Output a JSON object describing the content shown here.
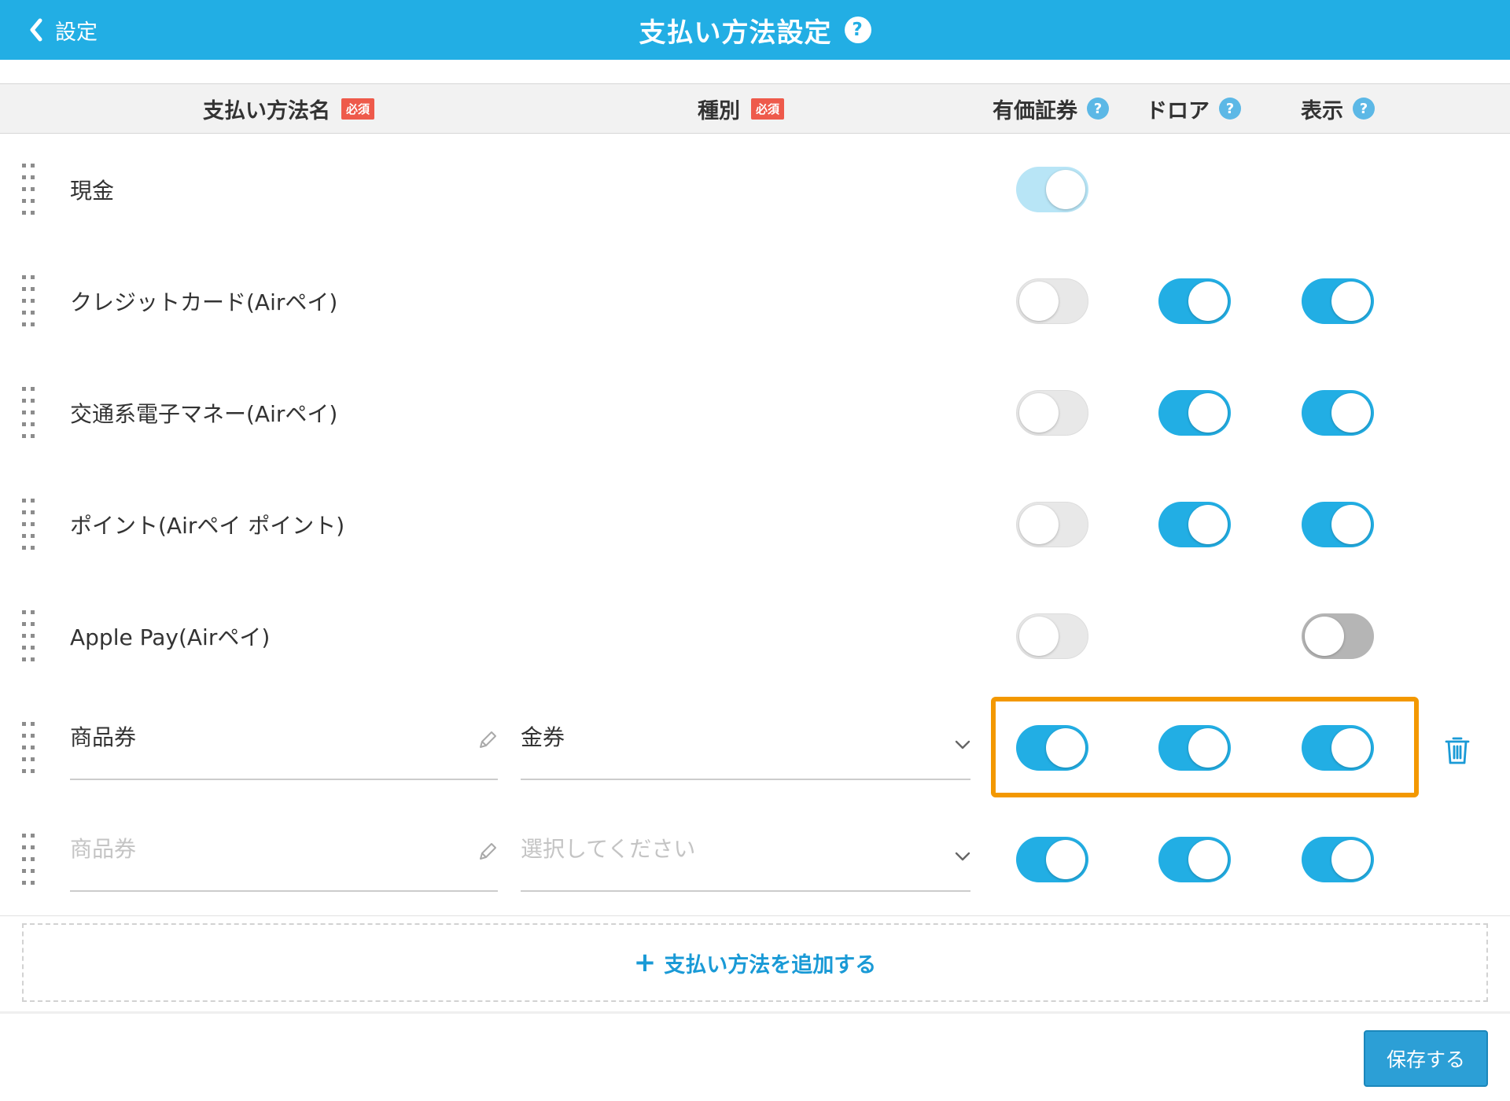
{
  "header": {
    "back_label": "設定",
    "title": "支払い方法設定",
    "help_glyph": "?"
  },
  "columns": {
    "name": "支払い方法名",
    "type": "種別",
    "required_badge": "必須",
    "securities": "有価証券",
    "drawer": "ドロア",
    "display": "表示",
    "help_glyph": "?"
  },
  "rows": [
    {
      "name": "現金",
      "securities": "on-disabled",
      "drawer": null,
      "display": null
    },
    {
      "name": "クレジットカード(Airペイ)",
      "securities": "off",
      "drawer": "on",
      "display": "on"
    },
    {
      "name": "交通系電子マネー(Airペイ)",
      "securities": "off",
      "drawer": "on",
      "display": "on"
    },
    {
      "name": "ポイント(Airペイ ポイント)",
      "securities": "off",
      "drawer": "on",
      "display": "on"
    },
    {
      "name": "Apple Pay(Airペイ)",
      "securities": "off",
      "drawer": null,
      "display": "off"
    }
  ],
  "edit_rows": [
    {
      "name_value": "商品券",
      "name_placeholder": "",
      "type_value": "金券",
      "type_placeholder": "",
      "securities": "on",
      "drawer": "on",
      "display": "on",
      "highlighted": true
    },
    {
      "name_value": "",
      "name_placeholder": "商品券",
      "type_value": "",
      "type_placeholder": "選択してください",
      "securities": "on",
      "drawer": "on",
      "display": "on",
      "highlighted": false
    }
  ],
  "add_button": {
    "icon": "plus-icon",
    "label": "支払い方法を追加する"
  },
  "save_button": {
    "label": "保存する"
  },
  "colors": {
    "header": "#22aee4",
    "toggle_on": "#22aee4",
    "highlight": "#f39800",
    "required_badge": "#ee5a4b",
    "link": "#1a9ad6"
  }
}
